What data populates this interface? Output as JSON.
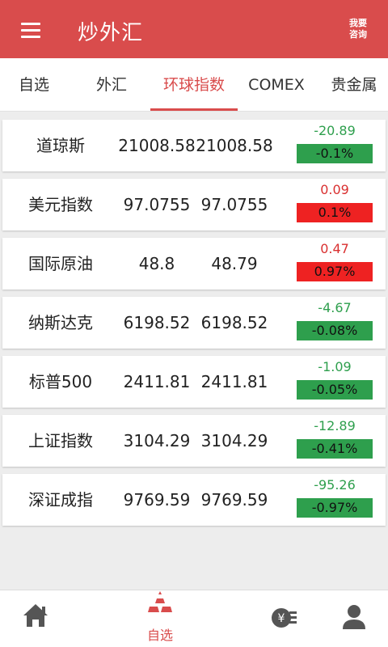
{
  "header": {
    "title": "炒外汇",
    "consult_line1": "我要",
    "consult_line2": "咨询"
  },
  "tabs": [
    {
      "label": "自选"
    },
    {
      "label": "外汇"
    },
    {
      "label": "环球指数"
    },
    {
      "label": "COMEX"
    },
    {
      "label": "贵金属"
    }
  ],
  "active_tab": "环球指数",
  "rows": [
    {
      "name": "道琼斯",
      "price1": "21008.58",
      "price2": "21008.58",
      "change": "-20.89",
      "percent": "-0.1%",
      "direction": "down"
    },
    {
      "name": "美元指数",
      "price1": "97.0755",
      "price2": "97.0755",
      "change": "0.09",
      "percent": "0.1%",
      "direction": "up"
    },
    {
      "name": "国际原油",
      "price1": "48.8",
      "price2": "48.79",
      "change": "0.47",
      "percent": "0.97%",
      "direction": "up"
    },
    {
      "name": "纳斯达克",
      "price1": "6198.52",
      "price2": "6198.52",
      "change": "-4.67",
      "percent": "-0.08%",
      "direction": "down"
    },
    {
      "name": "标普500",
      "price1": "2411.81",
      "price2": "2411.81",
      "change": "-1.09",
      "percent": "-0.05%",
      "direction": "down"
    },
    {
      "name": "上证指数",
      "price1": "3104.29",
      "price2": "3104.29",
      "change": "-12.89",
      "percent": "-0.41%",
      "direction": "down"
    },
    {
      "name": "深证成指",
      "price1": "9769.59",
      "price2": "9769.59",
      "change": "-95.26",
      "percent": "-0.97%",
      "direction": "down"
    }
  ],
  "bottom_nav": [
    {
      "icon": "home-icon",
      "label": ""
    },
    {
      "icon": "gold-bars-icon",
      "label": "自选"
    },
    {
      "icon": "yuan-coin-icon",
      "label": ""
    },
    {
      "icon": "user-icon",
      "label": ""
    }
  ],
  "colors": {
    "brand": "#d94c4c",
    "up": "#ee2222",
    "down": "#2e9f4d",
    "icon_gray": "#555555"
  }
}
